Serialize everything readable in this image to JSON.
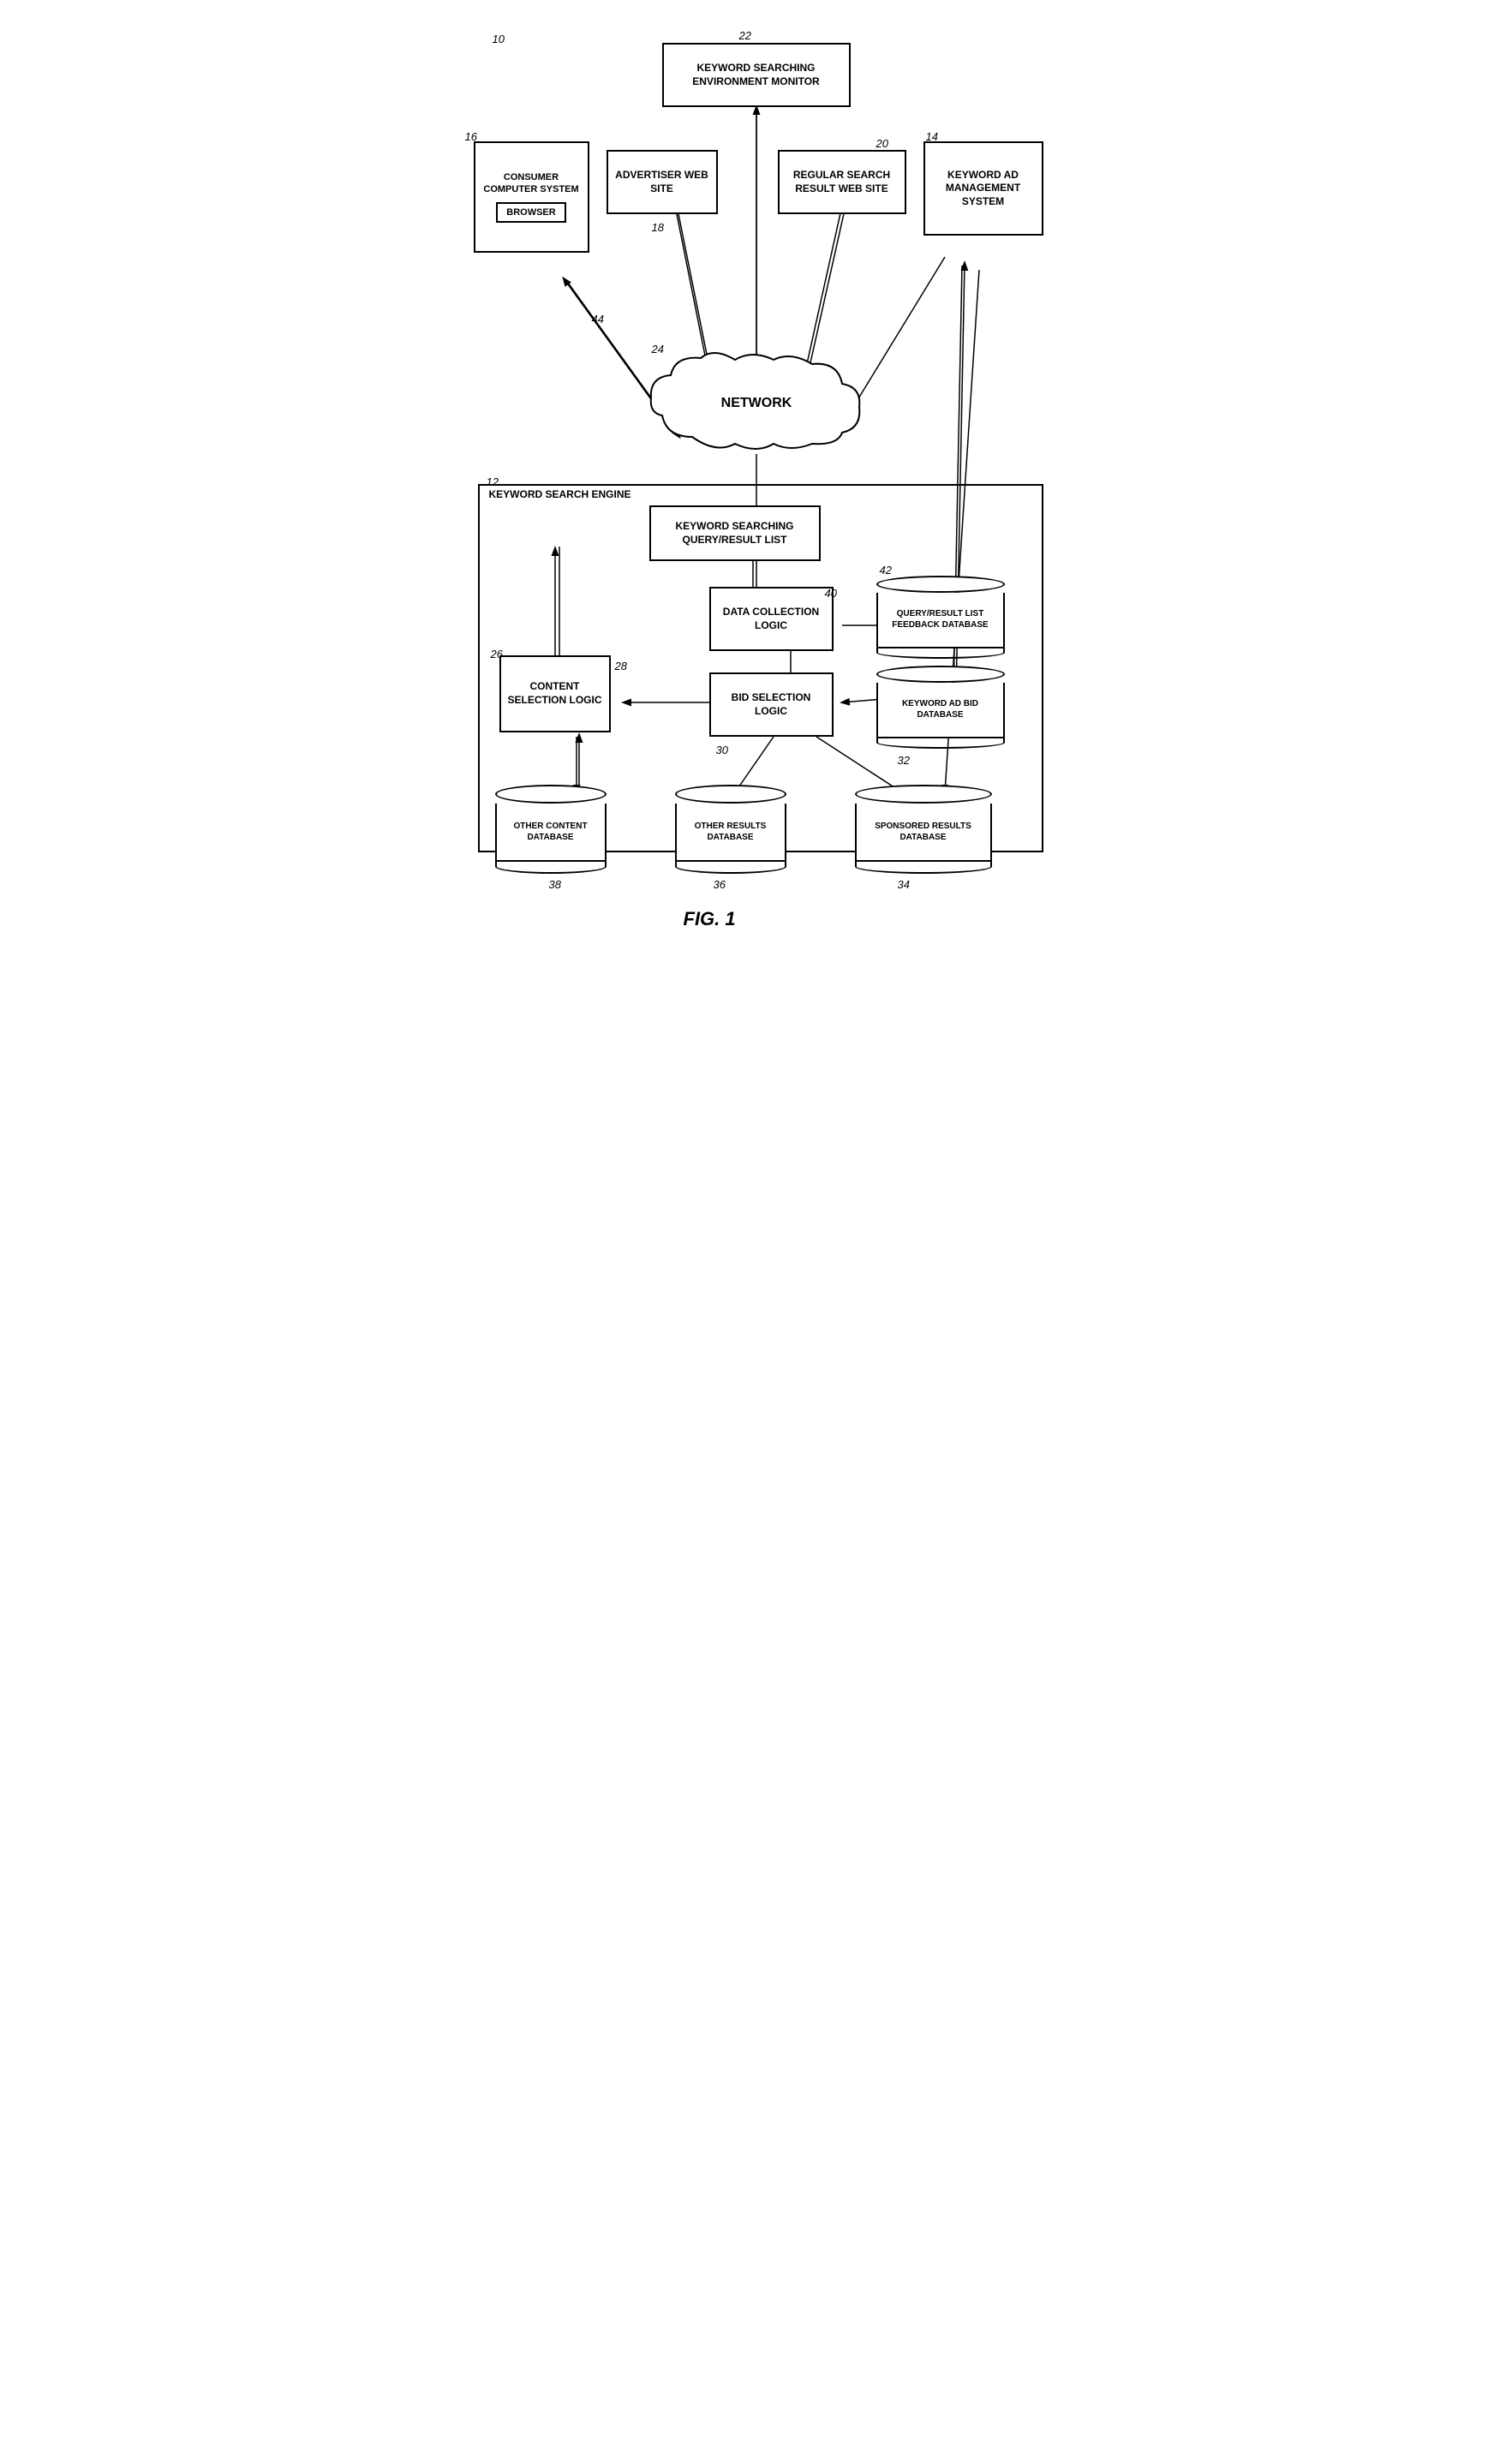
{
  "diagram": {
    "title": "FIG. 1",
    "ref_main": "10",
    "nodes": {
      "keyword_search_engine_label": "KEYWORD SEARCH ENGINE",
      "keyword_searching_env": "KEYWORD SEARCHING ENVIRONMENT MONITOR",
      "consumer_computer": "CONSUMER COMPUTER SYSTEM",
      "browser": "BROWSER",
      "advertiser_web": "ADVERTISER WEB SITE",
      "regular_search": "REGULAR SEARCH RESULT WEB SITE",
      "keyword_ad_mgmt": "KEYWORD AD MANAGEMENT SYSTEM",
      "network": "NETWORK",
      "keyword_query_result": "KEYWORD SEARCHING QUERY/RESULT LIST",
      "data_collection": "DATA COLLECTION LOGIC",
      "query_result_db": "QUERY/RESULT LIST FEEDBACK DATABASE",
      "bid_selection": "BID SELECTION LOGIC",
      "keyword_ad_bid_db": "KEYWORD AD BID DATABASE",
      "content_selection": "CONTENT SELECTION LOGIC",
      "other_content_db": "OTHER CONTENT DATABASE",
      "other_results_db": "OTHER RESULTS DATABASE",
      "sponsored_results_db": "SPONSORED RESULTS DATABASE"
    },
    "ref_numbers": {
      "r10": "10",
      "r12": "12",
      "r14": "14",
      "r16": "16",
      "r18": "18",
      "r20": "20",
      "r22": "22",
      "r24": "24",
      "r26": "26",
      "r28": "28",
      "r30": "30",
      "r32": "32",
      "r34": "34",
      "r36": "36",
      "r38": "38",
      "r40": "40",
      "r42": "42",
      "r44": "44"
    }
  }
}
